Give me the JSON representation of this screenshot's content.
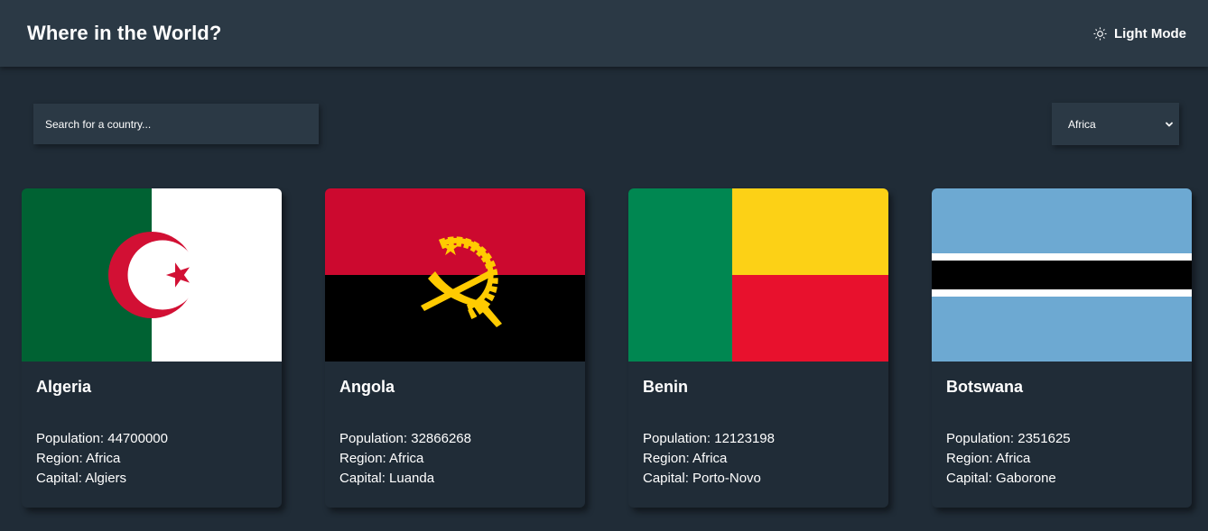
{
  "header": {
    "title": "Where in the World?",
    "mode_toggle_label": "Light Mode",
    "mode_icon": "sun-icon"
  },
  "search": {
    "placeholder": "Search for a country..."
  },
  "region_filter": {
    "selected": "Africa",
    "icon": "chevron-down-icon"
  },
  "labels": {
    "population": "Population:",
    "region": "Region:",
    "capital": "Capital:"
  },
  "countries": [
    {
      "name": "Algeria",
      "population": "44700000",
      "region": "Africa",
      "capital": "Algiers",
      "flag_icon": "algeria-flag"
    },
    {
      "name": "Angola",
      "population": "32866268",
      "region": "Africa",
      "capital": "Luanda",
      "flag_icon": "angola-flag"
    },
    {
      "name": "Benin",
      "population": "12123198",
      "region": "Africa",
      "capital": "Porto-Novo",
      "flag_icon": "benin-flag"
    },
    {
      "name": "Botswana",
      "population": "2351625",
      "region": "Africa",
      "capital": "Gaborone",
      "flag_icon": "botswana-flag"
    }
  ],
  "colors": {
    "background": "#202c37",
    "elements": "#2b3945",
    "text": "#ffffff"
  }
}
